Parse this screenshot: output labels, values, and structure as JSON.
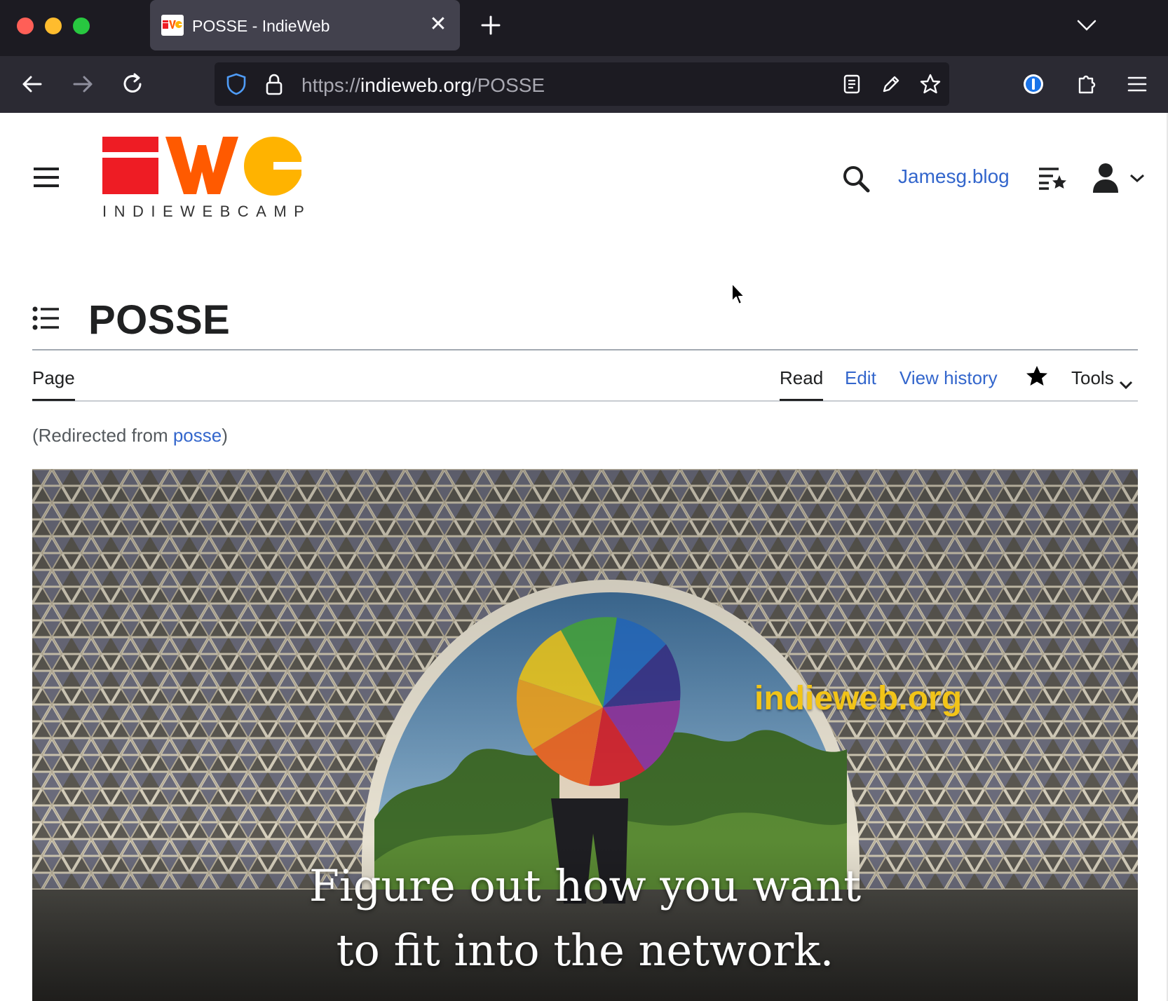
{
  "browser": {
    "tab_title": "POSSE - IndieWeb",
    "tab_close": "✕",
    "url_scheme": "https://",
    "url_host": "indieweb.org",
    "url_path": "/POSSE"
  },
  "site": {
    "logo_caption": "INDIEWEBCAMP",
    "user_link": "Jamesg.blog",
    "colors": {
      "logo_red": "#ee1c24",
      "logo_orange": "#ff5a00",
      "logo_yellow": "#ffb300",
      "link": "#3366cc"
    }
  },
  "article": {
    "title": "POSSE",
    "tabs": {
      "page": "Page",
      "read": "Read",
      "edit": "Edit",
      "history": "View history",
      "tools": "Tools"
    },
    "redirect_prefix": "(Redirected from ",
    "redirect_link": "posse",
    "redirect_suffix": ")"
  },
  "hero": {
    "brand": "indieweb.org",
    "caption_line1": "Figure out how you want",
    "caption_line2": "to fit into the network."
  }
}
